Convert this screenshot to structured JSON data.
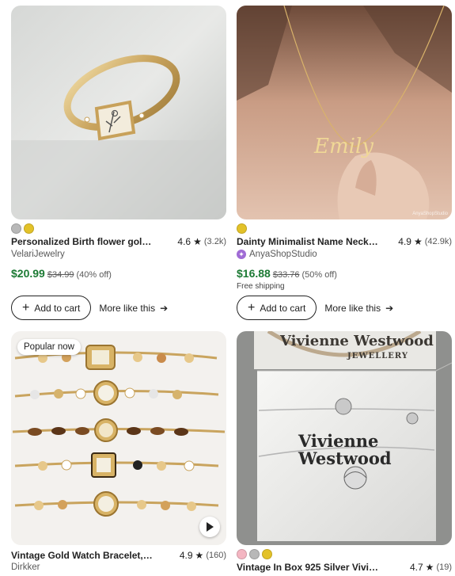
{
  "cards": [
    {
      "title": "Personalized Birth flower gold ring...",
      "rating": "4.6",
      "review_count": "(3.2k)",
      "shop": "VelariJewelry",
      "price": "$20.99",
      "original_price": "$34.99",
      "discount": "(40% off)",
      "swatches": [
        "#b8b8b8",
        "#e3c229"
      ],
      "add_to_cart": "Add to cart",
      "more_like_this": "More like this"
    },
    {
      "title": "Dainty Minimalist Name Necklace...",
      "rating": "4.9",
      "review_count": "(42.9k)",
      "shop": "AnyaShopStudio",
      "price": "$16.88",
      "original_price": "$33.76",
      "discount": "(50% off)",
      "shipping": "Free shipping",
      "image_watermark": "AnyaShopStudio",
      "swatches": [
        "#e3c229"
      ],
      "add_to_cart": "Add to cart",
      "more_like_this": "More like this"
    },
    {
      "badge": "Popular now",
      "title": "Vintage Gold Watch Bracelet,Re...",
      "rating": "4.9",
      "review_count": "(160)",
      "shop": "Dirkker"
    },
    {
      "title": "Vintage In Box 925 Silver Vivienne...",
      "rating": "4.7",
      "review_count": "(19)",
      "image_text_top": "Vivienne Westwood",
      "image_text_sub": "JEWELLERY",
      "image_text_box": "Vivienne Westwood",
      "swatches": [
        "#f4b6c2",
        "#b8b8b8",
        "#e3c229"
      ]
    }
  ],
  "colors": {
    "price_green": "#1c7a34",
    "star": "#222222",
    "star_seller": "#a06cd5"
  },
  "icons": {
    "add": "plus-icon",
    "arrow": "arrow-right-icon",
    "star": "star-icon",
    "play": "play-icon"
  }
}
